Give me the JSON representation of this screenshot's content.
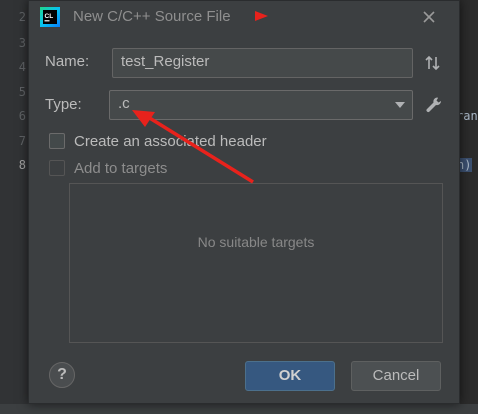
{
  "editor": {
    "line_numbers": [
      "2",
      "3",
      "4",
      "5",
      "6",
      "7",
      "8"
    ],
    "peek_right_1": "ran",
    "peek_right_2": "n)"
  },
  "dialog": {
    "title": "New C/C++ Source File",
    "app_logo_text": "CL",
    "name_label": "Name:",
    "name_value": "test_Register",
    "type_label": "Type:",
    "type_value": ".c",
    "create_header_label": "Create an associated header",
    "create_header_checked": false,
    "add_targets_label": "Add to targets",
    "add_targets_checked": false,
    "targets_empty_text": "No suitable targets",
    "help_label": "?",
    "ok_label": "OK",
    "cancel_label": "Cancel"
  },
  "icons": {
    "logo": "clion-logo-icon",
    "close": "close-icon",
    "sort": "sort-arrows-icon",
    "dropdown": "chevron-down-icon",
    "settings": "wrench-icon"
  },
  "colors": {
    "dialog_bg": "#3c3f41",
    "primary_button": "#365880",
    "annotation_red": "#e8221c"
  }
}
